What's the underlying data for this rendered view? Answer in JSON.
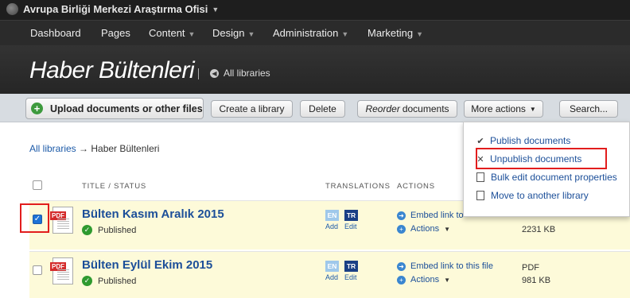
{
  "header": {
    "org_name": "Avrupa Birliği Merkezi Araştırma Ofisi",
    "nav": [
      "Dashboard",
      "Pages",
      "Content",
      "Design",
      "Administration",
      "Marketing"
    ],
    "page_title": "Haber Bültenleri",
    "all_libraries_link": "All libraries"
  },
  "toolbar": {
    "upload_label": "Upload documents or other files",
    "create_library_label": "Create a library",
    "delete_label": "Delete",
    "reorder_em": "Reorder",
    "reorder_rest": "documents",
    "more_actions_label": "More actions",
    "search_label": "Search..."
  },
  "breadcrumb": {
    "root": "All libraries",
    "arrow": " → ",
    "current": "Haber Bültenleri"
  },
  "table": {
    "headers": {
      "title_status": "TITLE / STATUS",
      "translations": "TRANSLATIONS",
      "actions": "ACTIONS"
    },
    "rows": [
      {
        "title": "Bülten Kasım Aralık 2015",
        "status": "Published",
        "checked": true,
        "lang_en": "EN",
        "lang_tr": "TR",
        "lang_add": "Add",
        "lang_edit": "Edit",
        "action_embed": "Embed link to",
        "action_actions": "Actions",
        "file_type": "",
        "file_size": "2231 KB",
        "file_badge": "PDF"
      },
      {
        "title": "Bülten Eylül Ekim 2015",
        "status": "Published",
        "checked": false,
        "lang_en": "EN",
        "lang_tr": "TR",
        "lang_add": "Add",
        "lang_edit": "Edit",
        "action_embed": "Embed link to this file",
        "action_actions": "Actions",
        "file_type": "PDF",
        "file_size": "981 KB",
        "file_badge": "PDF"
      }
    ]
  },
  "more_actions_menu": {
    "items": [
      "Publish documents",
      "Unpublish documents",
      "Bulk edit document properties",
      "Move to another library"
    ]
  },
  "colors": {
    "link": "#1c4f99",
    "highlight": "#e21d1d",
    "row_bg": "#fdfad9",
    "toolbar_bg": "#d7dce1"
  }
}
